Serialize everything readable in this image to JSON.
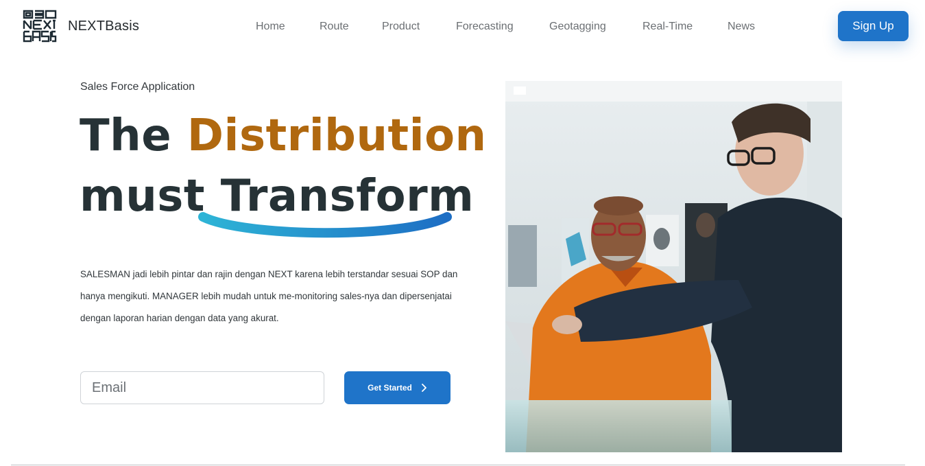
{
  "header": {
    "brand": "NEXTBasis",
    "nav": [
      "Home",
      "Route",
      "Product",
      "Forecasting",
      "Geotagging",
      "Real-Time",
      "News"
    ],
    "signup_label": "Sign Up"
  },
  "hero": {
    "eyebrow": "Sales Force Application",
    "headline_line1_prefix": "The ",
    "headline_line1_accent": "Distribution",
    "headline_line2": "must Transform",
    "description": "SALESMAN jadi lebih pintar dan rajin dengan NEXT karena lebih terstandar sesuai SOP dan hanya mengikuti. MANAGER lebih mudah untuk me-monitoring sales-nya dan dipersenjatai dengan laporan harian dengan data yang akurat.",
    "email_placeholder": "Email",
    "cta_label": "Get Started"
  },
  "icons": {
    "logo": "nextbasis-logo-icon",
    "cta_arrow": "chevron-right-icon"
  },
  "colors": {
    "primary": "#1f74c9",
    "accent": "#b0680f",
    "heading": "#263236"
  }
}
